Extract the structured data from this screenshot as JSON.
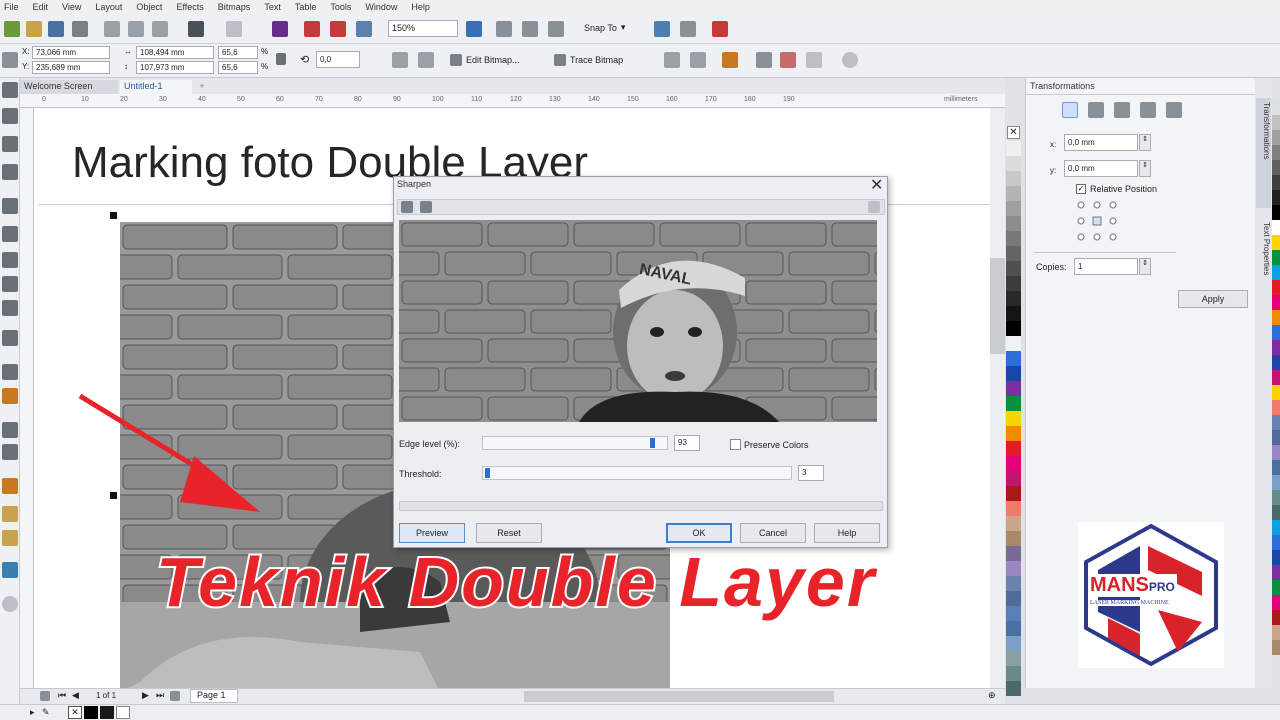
{
  "menu": [
    "File",
    "Edit",
    "View",
    "Layout",
    "Object",
    "Effects",
    "Bitmaps",
    "Text",
    "Table",
    "Tools",
    "Window",
    "Help"
  ],
  "toolbar": {
    "zoom": "150%",
    "snap_label": "Snap To",
    "x_pos": "73,066 mm",
    "y_pos": "235,689 mm",
    "width": "108,494 mm",
    "height": "107,973 mm",
    "scale_x": "65,6",
    "scale_y": "65,6",
    "percent": "%",
    "angle": "0,0",
    "edit_bitmap": "Edit Bitmap...",
    "trace_bitmap": "Trace Bitmap"
  },
  "tabs": [
    "Welcome Screen",
    "Untitled-1"
  ],
  "ruler_unit": "millimeters",
  "ruler_ticks": [
    "0",
    "10",
    "20",
    "30",
    "40",
    "50",
    "60",
    "70",
    "80",
    "90",
    "100",
    "110",
    "120",
    "130",
    "140",
    "150",
    "160",
    "170",
    "180",
    "190"
  ],
  "canvas": {
    "title": "Marking foto Double Layer",
    "overlay": "Teknik Double Layer"
  },
  "dialog": {
    "title": "Sharpen",
    "edge_label": "Edge level (%):",
    "edge_value": "93",
    "edge_level": 0.93,
    "preserve_label": "Preserve Colors",
    "threshold_label": "Threshold:",
    "threshold_value": "3",
    "threshold_level": 0.0,
    "preview_btn": "Preview",
    "reset_btn": "Reset",
    "ok_btn": "OK",
    "cancel_btn": "Cancel",
    "help_btn": "Help",
    "cap_text": "NAVAL"
  },
  "docker": {
    "title": "Transformations",
    "x_label": "x:",
    "x_value": "0,0 mm",
    "y_label": "y:",
    "y_value": "0,0 mm",
    "relative_label": "Relative Position",
    "copies_label": "Copies:",
    "copies_value": "1",
    "apply_btn": "Apply",
    "side_tabs": [
      "Transformations",
      "Text Properties"
    ]
  },
  "status": {
    "page_count": "1 of 1",
    "page_tab": "Page 1"
  },
  "logo": {
    "brand": "MANS",
    "brand_suffix": "PRO",
    "tagline": "LASER MARKING MACHINE"
  },
  "colors": {
    "accent_red": "#e8242a",
    "logo_blue": "#2d3a8c",
    "logo_red": "#d8232a"
  }
}
